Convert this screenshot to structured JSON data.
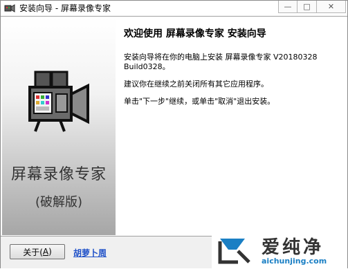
{
  "window": {
    "title": "安装向导 - 屏幕录像专家",
    "minimize_glyph": "—",
    "maximize_glyph": "□",
    "close_glyph": "✕"
  },
  "sidebar": {
    "product_name": "屏幕录像专家",
    "edition": "(破解版)",
    "icon": "video-camera-icon"
  },
  "main": {
    "heading": "欢迎使用 屏幕录像专家 安装向导",
    "paragraphs": [
      "安装向导将在你的电脑上安装 屏幕录像专家 V20180328 Build0328。",
      "建议你在继续之前关闭所有其它应用程序。",
      "单击\"下一步\"继续，或单击\"取消\"退出安装。"
    ]
  },
  "footer": {
    "about_label": "关于(",
    "about_accel": "A",
    "about_suffix": ")",
    "link_text": "胡萝卜周"
  },
  "watermark": {
    "brand": "爱纯净",
    "url": "aichunjing.com"
  },
  "colors": {
    "link": "#1e50c8",
    "watermark_url": "#1a7fc4"
  }
}
